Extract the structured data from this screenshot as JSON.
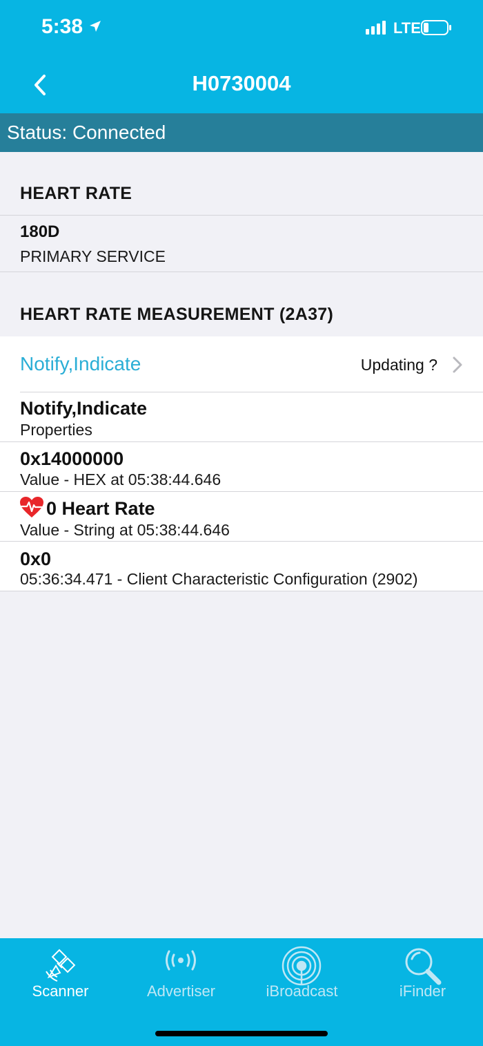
{
  "status_bar": {
    "time": "5:38",
    "network": "LTE"
  },
  "nav": {
    "title": "H0730004"
  },
  "connection_status": "Status: Connected",
  "service": {
    "header": "HEART RATE",
    "uuid": "180D",
    "type": "PRIMARY SERVICE"
  },
  "characteristic": {
    "header": "HEART RATE MEASUREMENT (2A37)",
    "action_label": "Notify,Indicate",
    "action_status": "Updating ?",
    "rows": [
      {
        "primary": "Notify,Indicate",
        "secondary": "Properties"
      },
      {
        "primary": "0x14000000",
        "secondary": "Value - HEX at 05:38:44.646"
      },
      {
        "primary": "0 Heart Rate",
        "secondary": "Value - String at 05:38:44.646"
      },
      {
        "primary": "0x0",
        "secondary": "05:36:34.471 - Client Characteristic Configuration (2902)"
      }
    ]
  },
  "tabs": [
    {
      "label": "Scanner",
      "icon": "satellite-icon",
      "active": true
    },
    {
      "label": "Advertiser",
      "icon": "broadcast-icon",
      "active": false
    },
    {
      "label": "iBroadcast",
      "icon": "ibeacon-icon",
      "active": false
    },
    {
      "label": "iFinder",
      "icon": "magnifier-icon",
      "active": false
    }
  ],
  "colors": {
    "header": "#07b5e3",
    "status_strip": "#267f9a",
    "link": "#2aaed6",
    "background": "#f1f1f6",
    "heart": "#e8262a"
  }
}
